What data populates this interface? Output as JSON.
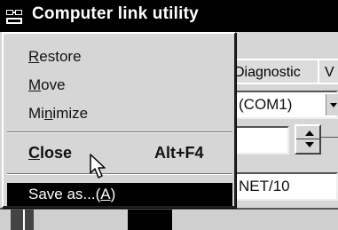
{
  "window": {
    "title": "Computer link utility"
  },
  "tabs": [
    {
      "label": "Diagnostic"
    },
    {
      "label": "V"
    }
  ],
  "fields": {
    "port_value": "(COM1)",
    "network_value": "NET/10"
  },
  "menu": {
    "restore": {
      "pre": "",
      "u": "R",
      "post": "estore"
    },
    "move": {
      "pre": "",
      "u": "M",
      "post": "ove"
    },
    "minimize": {
      "pre": "Mi",
      "u": "n",
      "post": "imize"
    },
    "close": {
      "pre": "",
      "u": "C",
      "post": "lose",
      "accel": "Alt+F4"
    },
    "saveas": {
      "pre": "Save as...(",
      "u": "A",
      "post": ")"
    }
  },
  "icons": {
    "app": "network-computer-icon",
    "cursor": "arrow-cursor-icon",
    "dropdown": "dropdown-arrow-icon",
    "spin": "spin-arrows-icon"
  },
  "colors": {
    "titlebar": "#000000",
    "menu_bg": "#d6d6d6",
    "highlight": "#000000"
  }
}
